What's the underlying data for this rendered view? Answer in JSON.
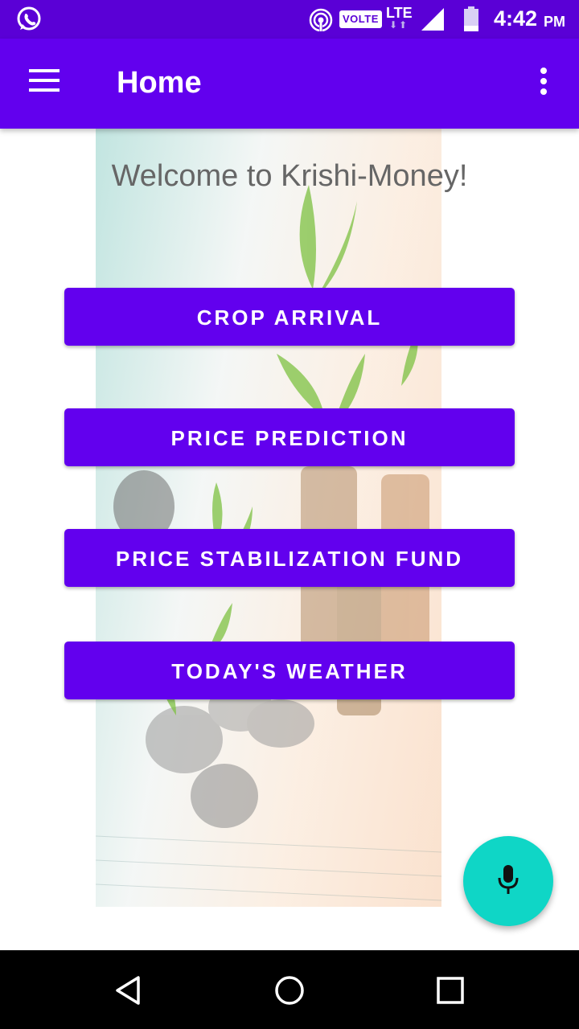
{
  "status_bar": {
    "volte_label": "VOLTE",
    "network_label": "LTE",
    "time": "4:42",
    "ampm": "PM"
  },
  "app_bar": {
    "title": "Home"
  },
  "main": {
    "welcome_text": "Welcome to Krishi-Money!",
    "buttons": [
      {
        "label": "CROP ARRIVAL"
      },
      {
        "label": "PRICE PREDICTION"
      },
      {
        "label": "PRICE STABILIZATION FUND"
      },
      {
        "label": "TODAY'S WEATHER"
      }
    ]
  },
  "icons": {
    "status": [
      "whatsapp-icon",
      "hotspot-icon",
      "signal-icon",
      "battery-icon"
    ],
    "app_bar": [
      "menu-icon",
      "more-vert-icon"
    ],
    "fab": "mic-icon",
    "nav": [
      "back-icon",
      "home-icon",
      "recents-icon"
    ]
  },
  "colors": {
    "status_bar": "#5a00d6",
    "app_bar": "#6200ee",
    "button": "#6200ee",
    "fab": "#0fd6c6",
    "nav_bar": "#000000"
  }
}
